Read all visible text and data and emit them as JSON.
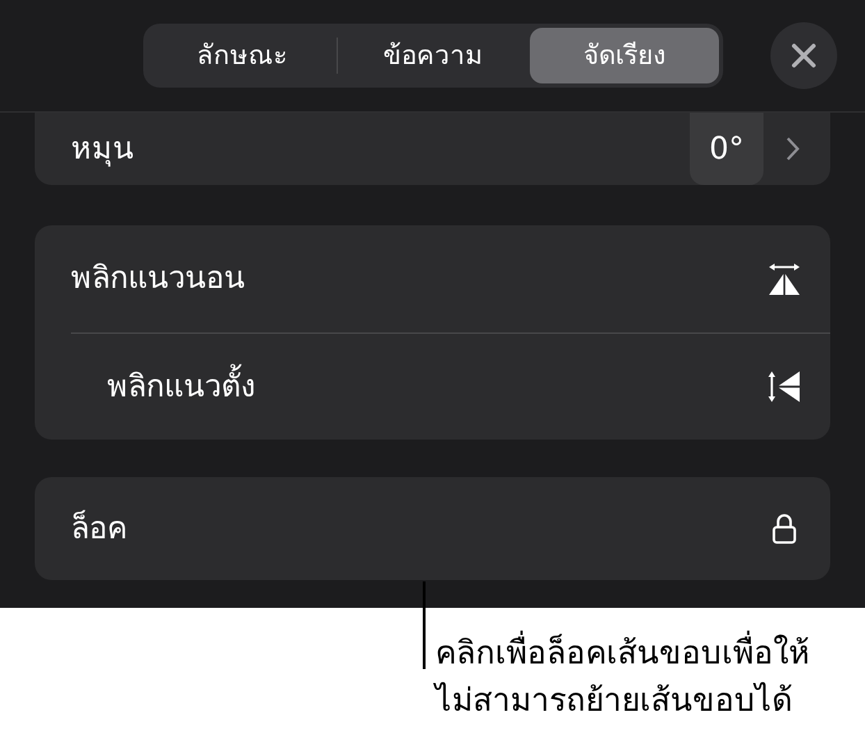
{
  "tabs": [
    {
      "label": "ลักษณะ",
      "selected": false
    },
    {
      "label": "ข้อความ",
      "selected": false
    },
    {
      "label": "จัดเรียง",
      "selected": true
    }
  ],
  "rotate": {
    "label": "หมุน",
    "value": "0°"
  },
  "flip_rows": [
    {
      "label": "พลิกแนวนอน",
      "kind": "flip-horizontal"
    },
    {
      "label": "พลิกแนวตั้ง",
      "kind": "flip-vertical"
    }
  ],
  "lock_row": {
    "label": "ล็อค",
    "kind": "lock"
  },
  "callout": {
    "lines": [
      "คลิกเพื่อล็อคเส้นขอบเพื่อให้",
      "ไม่สามารถย้ายเส้นขอบได้"
    ]
  }
}
